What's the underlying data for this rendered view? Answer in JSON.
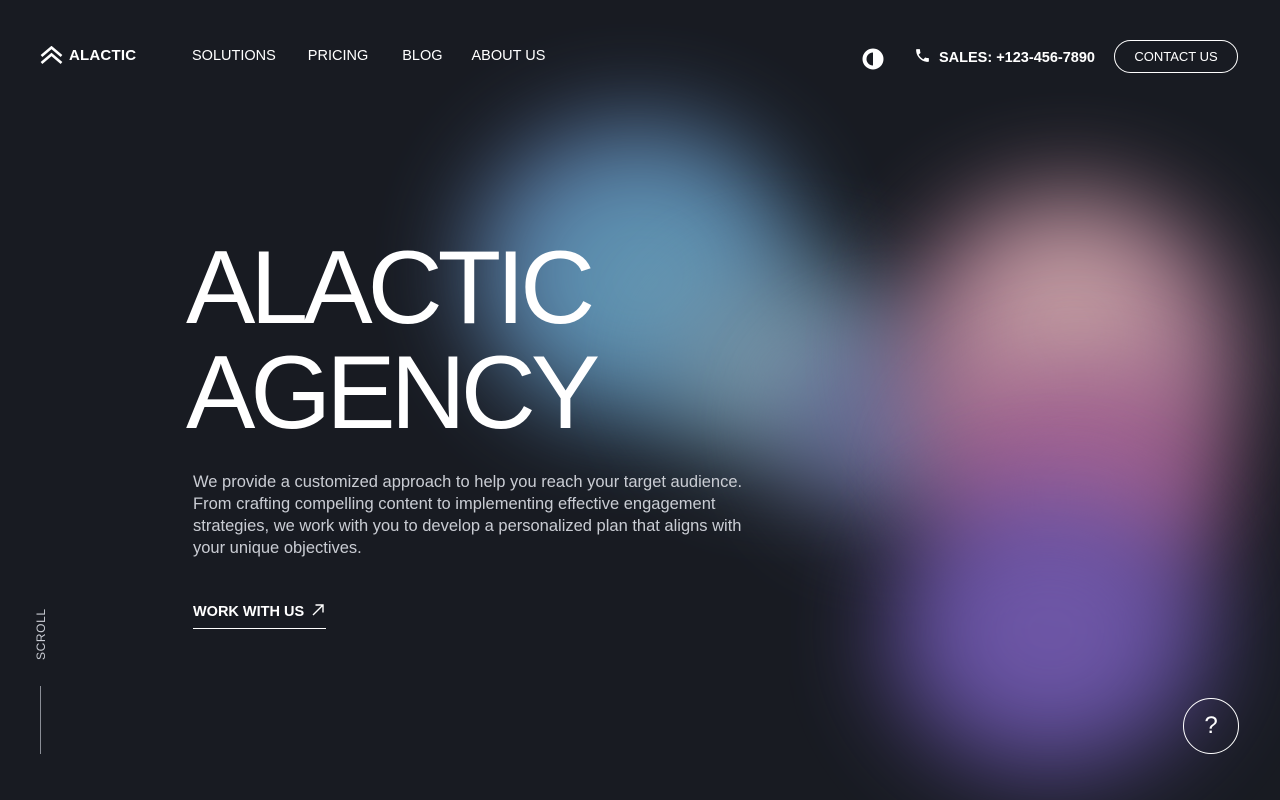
{
  "brand": {
    "name": "ALACTIC",
    "logo_icon": "double-chevron-up-logo"
  },
  "nav": {
    "items": [
      "SOLUTIONS",
      "PRICING",
      "BLOG",
      "ABOUT US"
    ]
  },
  "header": {
    "theme_toggle_icon": "contrast-icon",
    "phone_icon": "phone-icon",
    "phone_text": "SALES: +123-456-7890",
    "contact_label": "CONTACT US"
  },
  "hero": {
    "title_line1": "ALACTIC",
    "title_line2": "AGENCY",
    "description": "We provide a customized approach to help you reach your target audience. From crafting compelling content to implementing effective engagement strategies, we work with you to develop a personalized plan that aligns with your unique objectives.",
    "cta_label": "WORK WITH US",
    "cta_icon": "arrow-up-right-icon"
  },
  "side": {
    "scroll_label": "SCROLL"
  },
  "help": {
    "label": "?"
  },
  "colors": {
    "background": "#181b22",
    "text": "#ffffff",
    "muted_text": "#c9ccd3",
    "blob_blue": "#5a8fb3",
    "blob_peach": "#d8b7b2",
    "blob_pink": "#b46b95",
    "blob_violet": "#6652a6"
  }
}
